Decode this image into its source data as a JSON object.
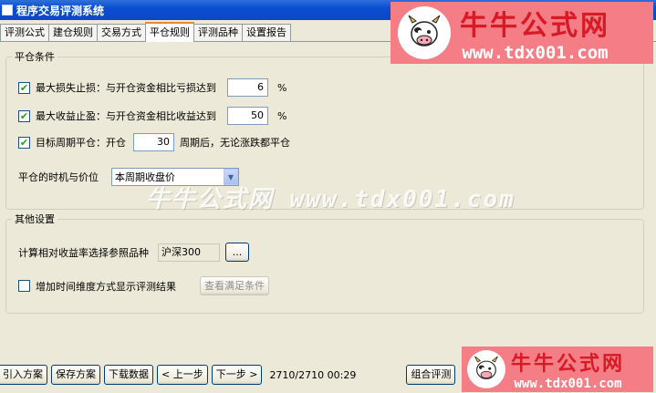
{
  "window": {
    "title": "程序交易评测系统"
  },
  "tabs": [
    {
      "label": "评测公式",
      "active": false
    },
    {
      "label": "建仓规则",
      "active": false
    },
    {
      "label": "交易方式",
      "active": false
    },
    {
      "label": "平仓规则",
      "active": true
    },
    {
      "label": "评测品种",
      "active": false
    },
    {
      "label": "设置报告",
      "active": false
    }
  ],
  "close_conditions": {
    "title": "平仓条件",
    "max_loss": {
      "label": "最大损失止损：与开仓资金相比亏损达到",
      "value": "6",
      "unit": "%"
    },
    "max_gain": {
      "label": "最大收益止盈：与开仓资金相比收益达到",
      "value": "50",
      "unit": "%"
    },
    "target_period": {
      "label": "目标周期平仓：开仓",
      "value": "30",
      "suffix": "周期后，无论涨跌都平仓"
    },
    "timing": {
      "label": "平仓的时机与价位",
      "selected": "本周期收盘价"
    }
  },
  "other_settings": {
    "title": "其他设置",
    "benchmark": {
      "label": "计算相对收益率选择参照品种",
      "value": "沪深300",
      "browse": "..."
    },
    "time_dim": {
      "label": "增加时间维度方式显示评测结果",
      "button": "查看满足条件"
    }
  },
  "statusbar": {
    "import": "引入方案",
    "save": "保存方案",
    "download": "下载数据",
    "prev": "< 上一步",
    "next": "下一步 >",
    "progress": "2710/2710 00:29",
    "combo": "组合评测"
  },
  "watermark": {
    "brand_cn": "牛牛公式网",
    "url": "www.tdx001.com",
    "middle": "牛牛公式网 www.tdx001.com"
  },
  "colors": {
    "accent_pink": "#f57e86",
    "brand_red": "#d81a26",
    "titlebar": "#0a4ed1"
  }
}
